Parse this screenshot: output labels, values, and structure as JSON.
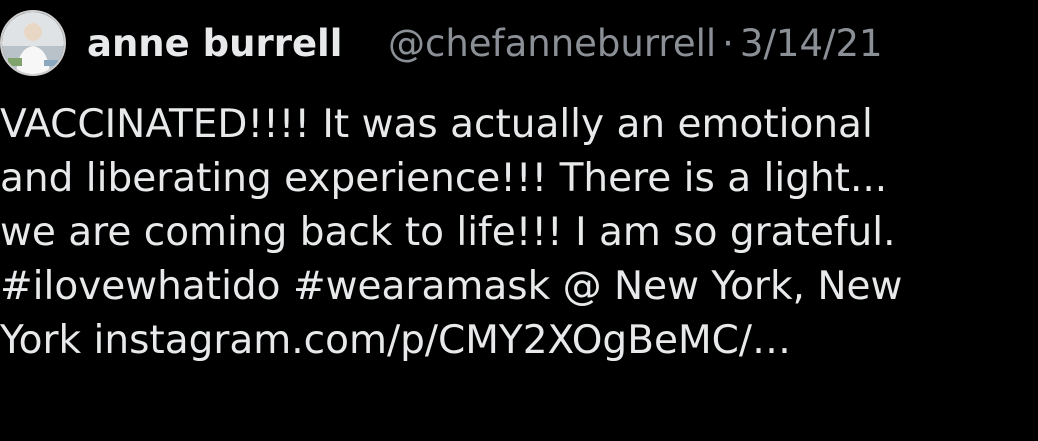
{
  "tweet": {
    "author": {
      "display_name": "anne burrell",
      "handle": "@chefanneburrell",
      "separator": "·",
      "date": "3/14/21",
      "avatar_icon": "profile-photo"
    },
    "text_lines": [
      "VACCINATED!!!! It was actually an emotional",
      "and liberating experience!!! There is a light...",
      "we are coming back to life!!! I am so grateful."
    ],
    "line4": {
      "hashtag1": "#ilovewhatido",
      "hashtag2": "#wearamask",
      "location": "@ New York, New"
    },
    "line5": {
      "location_tail": "York",
      "link": "instagram.com/p/CMY2XOgBeMC/...",
      "link_display": "instagram.com/p/CMY2XOgBeMC/…"
    }
  },
  "colors": {
    "background": "#000000",
    "text": "#e7e9ea",
    "secondary_text": "#8b9096"
  }
}
